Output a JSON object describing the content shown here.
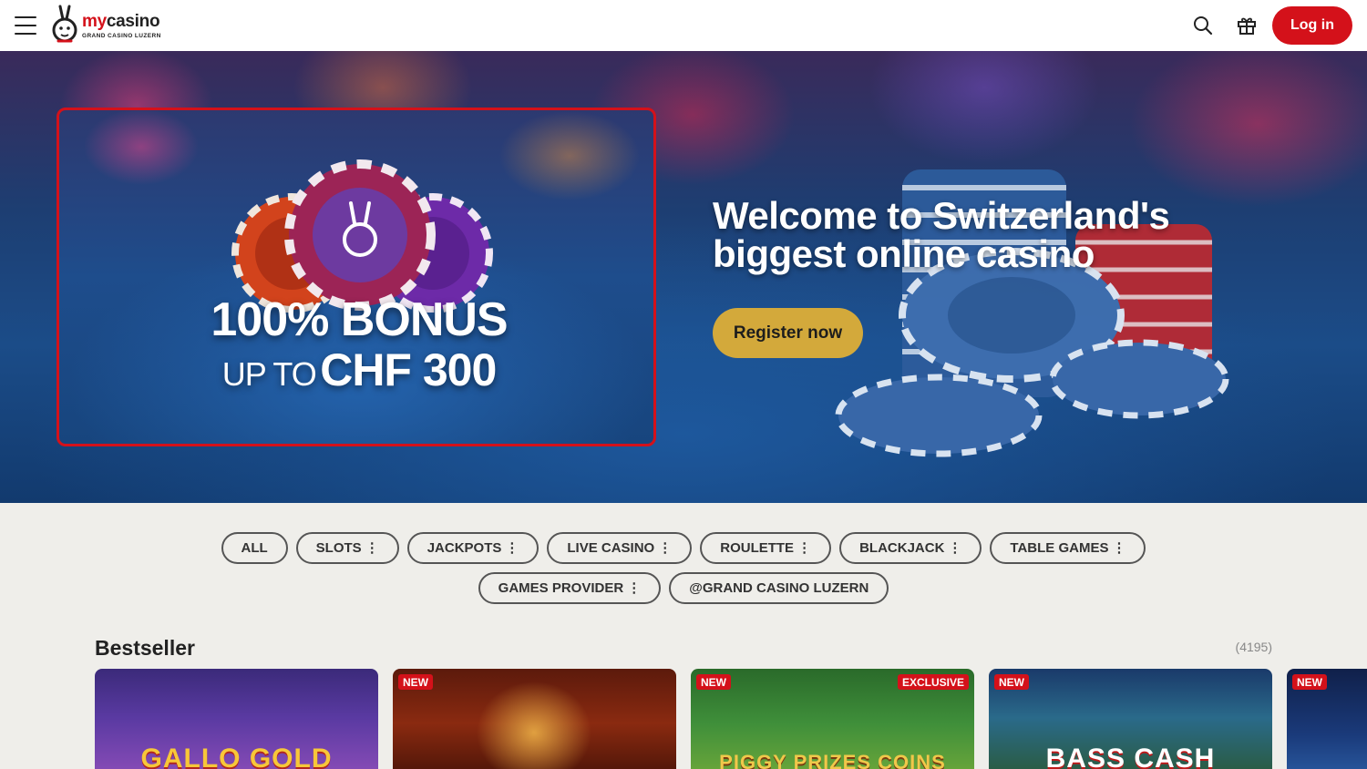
{
  "header": {
    "logo_my": "my",
    "logo_casino": "casino",
    "logo_sub": "GRAND CASINO LUZERN",
    "login_label": "Log in"
  },
  "hero": {
    "promo_main": "100% BONUS",
    "promo_upto": "UP TO",
    "promo_amount": "CHF 300",
    "title_line1": "Welcome to Switzerland's",
    "title_line2": "biggest online casino",
    "register_label": "Register now"
  },
  "filters": {
    "row1": [
      {
        "label": "ALL",
        "menu": false
      },
      {
        "label": "SLOTS",
        "menu": true
      },
      {
        "label": "JACKPOTS",
        "menu": true
      },
      {
        "label": "LIVE CASINO",
        "menu": true
      },
      {
        "label": "ROULETTE",
        "menu": true
      },
      {
        "label": "BLACKJACK",
        "menu": true
      },
      {
        "label": "TABLE GAMES",
        "menu": true
      }
    ],
    "row2": [
      {
        "label": "GAMES PROVIDER",
        "menu": true
      },
      {
        "label": "@GRAND CASINO LUZERN",
        "menu": false
      }
    ]
  },
  "bestseller": {
    "title": "Bestseller",
    "count": "(4195)",
    "tiles": [
      {
        "name": "GALLO GOLD",
        "badges": []
      },
      {
        "name": "",
        "badges": [
          "NEW"
        ]
      },
      {
        "name": "PIGGY PRIZES COINS",
        "badges": [
          "NEW",
          "EXCLUSIVE"
        ]
      },
      {
        "name": "BASS CASH",
        "badges": [
          "NEW"
        ]
      },
      {
        "name": "",
        "badges": [
          "NEW"
        ]
      }
    ]
  },
  "colors": {
    "brand_red": "#d4111a",
    "register_gold": "#d3a93b",
    "page_bg": "#efeeea"
  }
}
